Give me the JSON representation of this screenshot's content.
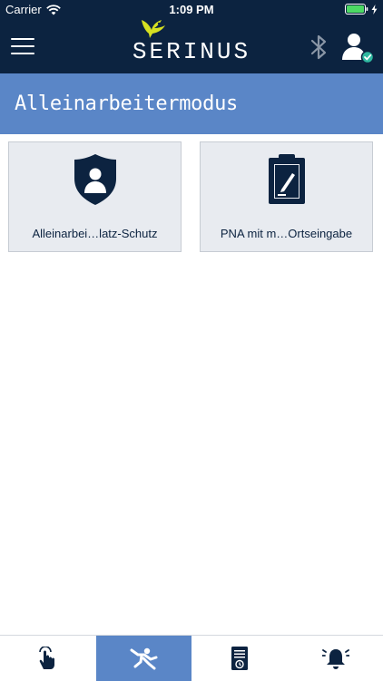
{
  "status_bar": {
    "carrier": "Carrier",
    "time": "1:09 PM"
  },
  "header": {
    "logo_text": "SERINUS"
  },
  "title": "Alleinarbeitermodus",
  "tiles": [
    {
      "label": "Alleinarbei…latz-Schutz",
      "icon": "shield-user-icon"
    },
    {
      "label": "PNA mit m…Ortseingabe",
      "icon": "clipboard-edit-icon"
    }
  ],
  "tabs": [
    {
      "icon": "touch-hand-icon",
      "active": false
    },
    {
      "icon": "fall-person-icon",
      "active": true
    },
    {
      "icon": "document-clock-icon",
      "active": false
    },
    {
      "icon": "alarm-bell-icon",
      "active": false
    }
  ],
  "colors": {
    "navy": "#0c2340",
    "accent": "#5a86c7",
    "tile_bg": "#e8ebf0",
    "logo_bird": "#d6e021",
    "status_ok": "#2fb8a0"
  }
}
